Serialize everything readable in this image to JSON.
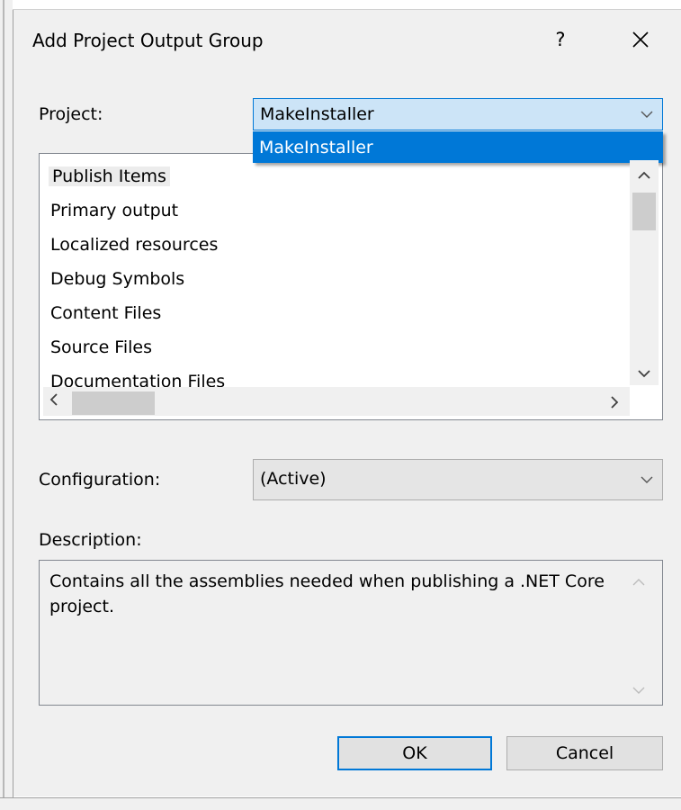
{
  "dialog": {
    "title": "Add Project Output Group",
    "help_label": "?",
    "close_label": "✕"
  },
  "project": {
    "label": "Project:",
    "selected": "MakeInstaller",
    "dropdown_options": [
      "MakeInstaller"
    ]
  },
  "output_groups": {
    "items": [
      "Publish Items",
      "Primary output",
      "Localized resources",
      "Debug Symbols",
      "Content Files",
      "Source Files",
      "Documentation Files"
    ],
    "selected_index": 0
  },
  "configuration": {
    "label": "Configuration:",
    "selected": "(Active)"
  },
  "description": {
    "label": "Description:",
    "text": "Contains all the assemblies needed when publishing a .NET Core project."
  },
  "buttons": {
    "ok": "OK",
    "cancel": "Cancel"
  },
  "icons": {
    "dropdown": "chevron-down-icon",
    "scroll_up": "scroll-up-icon",
    "scroll_down": "scroll-down-icon",
    "scroll_left": "scroll-left-icon",
    "scroll_right": "scroll-right-icon"
  },
  "colors": {
    "accent": "#0078d7",
    "selection_bg": "#cce4f7",
    "dialog_bg": "#f0f0f0"
  }
}
